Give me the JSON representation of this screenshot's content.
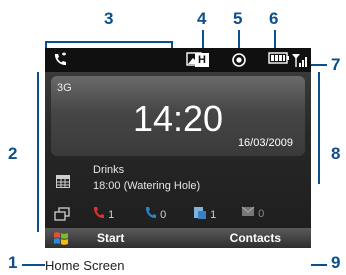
{
  "callouts": [
    "1",
    "2",
    "3",
    "4",
    "5",
    "6",
    "7",
    "8",
    "9"
  ],
  "status_bar": {
    "network_type": "3G"
  },
  "clock": {
    "time": "14:20",
    "date": "16/03/2009"
  },
  "appointment": {
    "title": "Drinks",
    "detail": "18:00 (Watering Hole)"
  },
  "notifications": {
    "missed_calls": "1",
    "voicemail": "0",
    "messages": "1",
    "email": "0"
  },
  "softkeys": {
    "left": "Start",
    "right": "Contacts"
  },
  "caption": "Home Screen",
  "colors": {
    "callout": "#0d4f8b",
    "missed_call": "#d9322f",
    "voicemail": "#2c86c6"
  }
}
